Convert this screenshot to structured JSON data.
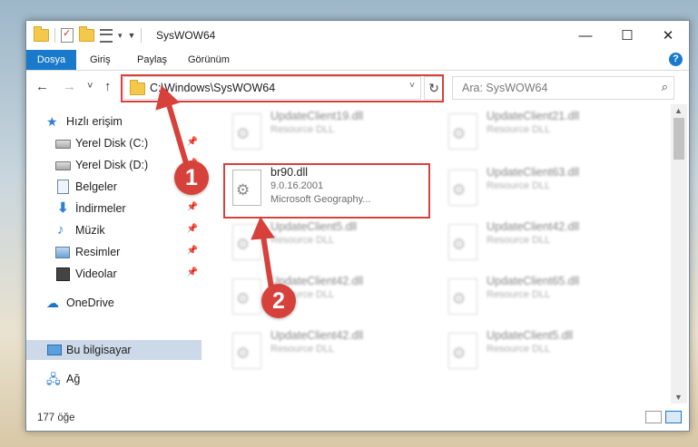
{
  "window": {
    "title": "SysWOW64",
    "minimize_glyph": "—",
    "maximize_glyph": "☐",
    "close_glyph": "✕"
  },
  "ribbon": {
    "tabs": [
      "Dosya",
      "Giriş",
      "Paylaş",
      "Görünüm"
    ],
    "help_glyph": "?"
  },
  "navbar": {
    "back_glyph": "←",
    "forward_glyph": "→",
    "recent_glyph": "˅",
    "up_glyph": "↑",
    "address": "C:\\Windows\\SysWOW64",
    "refresh_glyph": "↻",
    "search_placeholder": "Ara: SysWOW64",
    "search_glyph": "⌕"
  },
  "sidebar": {
    "items": [
      {
        "label": "Hızlı erişim",
        "icon": "quick-access-star-icon",
        "pinned": false
      },
      {
        "label": "Yerel Disk (C:)",
        "icon": "drive-icon",
        "pinned": true
      },
      {
        "label": "Yerel Disk (D:)",
        "icon": "drive-icon",
        "pinned": true
      },
      {
        "label": "Belgeler",
        "icon": "documents-icon",
        "pinned": true
      },
      {
        "label": "İndirmeler",
        "icon": "downloads-icon",
        "pinned": true
      },
      {
        "label": "Müzik",
        "icon": "music-icon",
        "pinned": true
      },
      {
        "label": "Resimler",
        "icon": "pictures-icon",
        "pinned": true
      },
      {
        "label": "Videolar",
        "icon": "videos-icon",
        "pinned": true
      },
      {
        "label": "OneDrive",
        "icon": "onedrive-cloud-icon",
        "pinned": false
      },
      {
        "label": "Bu bilgisayar",
        "icon": "this-pc-icon",
        "pinned": false,
        "selected": true
      },
      {
        "label": "Ağ",
        "icon": "network-icon",
        "pinned": false
      }
    ],
    "pin_glyph": "📌"
  },
  "files": [
    {
      "name": "UpdateClient19.dll",
      "desc": "Resource DLL",
      "blurred": true
    },
    {
      "name": "UpdateClient21.dll",
      "desc": "Resource DLL",
      "blurred": true
    },
    {
      "name": "br90.dll",
      "desc": "9.0.16.2001",
      "company": "Microsoft Geography...",
      "blurred": false
    },
    {
      "name": "UpdateClient63.dll",
      "desc": "Resource DLL",
      "blurred": true
    },
    {
      "name": "UpdateClient5.dll",
      "desc": "Resource DLL",
      "blurred": true
    },
    {
      "name": "UpdateClient42.dll",
      "desc": "Resource DLL",
      "blurred": true
    },
    {
      "name": "UpdateClient42.dll",
      "desc": "Resource DLL",
      "blurred": true
    },
    {
      "name": "UpdateClient65.dll",
      "desc": "Resource DLL",
      "blurred": true
    },
    {
      "name": "UpdateClient42.dll",
      "desc": "Resource DLL",
      "blurred": true
    },
    {
      "name": "UpdateClient5.dll",
      "desc": "Resource DLL",
      "blurred": true
    }
  ],
  "status": {
    "item_count": "177 öğe"
  },
  "callouts": [
    "1",
    "2"
  ],
  "colors": {
    "accent": "#1979ca",
    "highlight_red": "#d7413c",
    "selection": "#ccd9e8"
  }
}
